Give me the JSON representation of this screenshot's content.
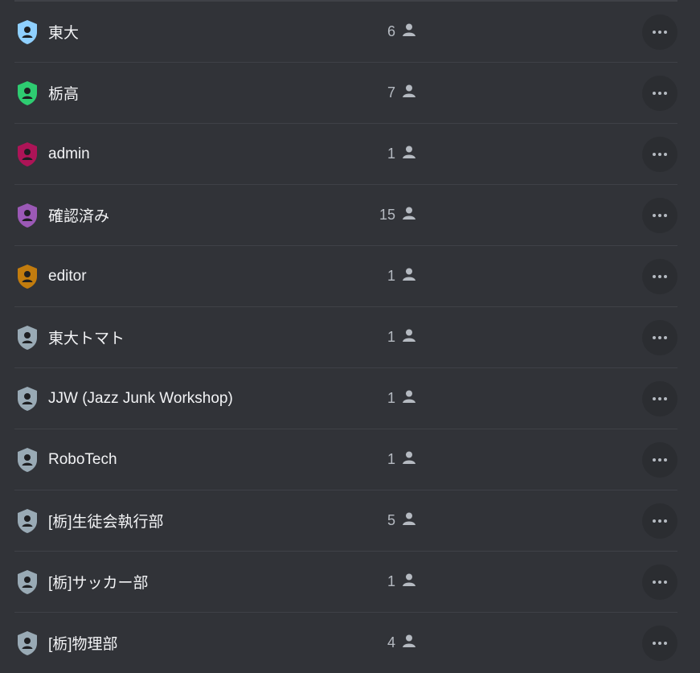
{
  "roles": [
    {
      "name": "東大",
      "count": "6",
      "color": "#8fd0ff"
    },
    {
      "name": "栃高",
      "count": "7",
      "color": "#2ecc71"
    },
    {
      "name": "admin",
      "count": "1",
      "color": "#ad1457"
    },
    {
      "name": "確認済み",
      "count": "15",
      "color": "#9b59b6"
    },
    {
      "name": "editor",
      "count": "1",
      "color": "#c27c0e"
    },
    {
      "name": "東大トマト",
      "count": "1",
      "color": "#99aab5"
    },
    {
      "name": "JJW (Jazz Junk Workshop)",
      "count": "1",
      "color": "#99aab5"
    },
    {
      "name": "RoboTech",
      "count": "1",
      "color": "#99aab5"
    },
    {
      "name": "[栃]生徒会執行部",
      "count": "5",
      "color": "#99aab5"
    },
    {
      "name": "[栃]サッカー部",
      "count": "1",
      "color": "#99aab5"
    },
    {
      "name": "[栃]物理部",
      "count": "4",
      "color": "#99aab5"
    }
  ],
  "icons": {
    "role": "shield-user-icon",
    "member": "person-icon",
    "more": "more-horizontal-icon"
  }
}
